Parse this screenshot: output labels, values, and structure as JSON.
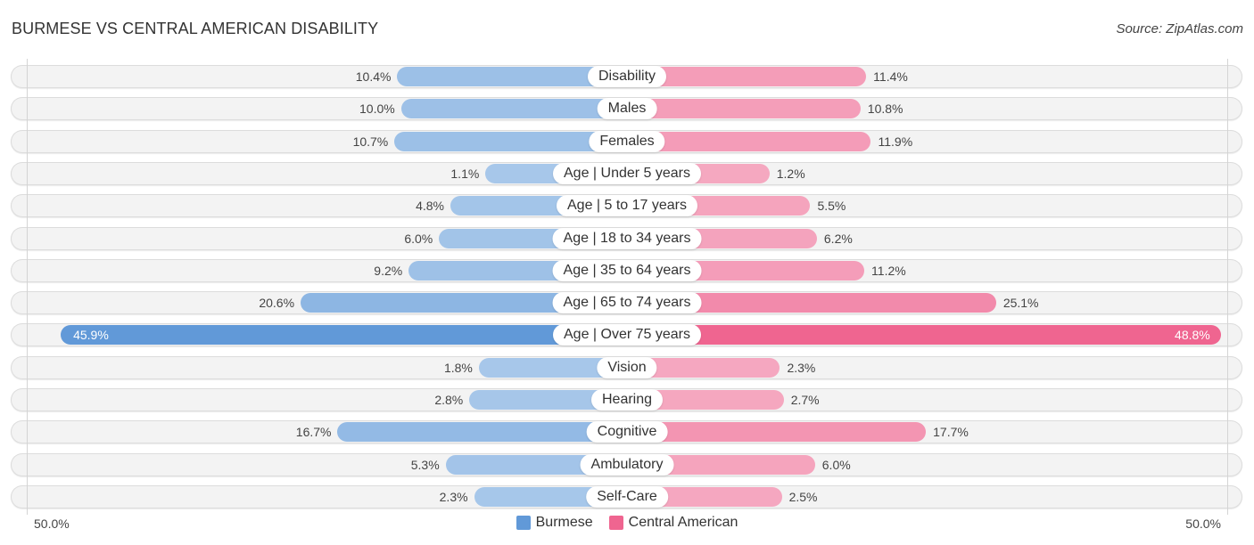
{
  "header": {
    "title": "BURMESE VS CENTRAL AMERICAN DISABILITY",
    "source": "Source: ZipAtlas.com"
  },
  "colors": {
    "burmese_light": "#a8c8ea",
    "burmese_strong": "#6199d8",
    "central_american_light": "#f5a9c1",
    "central_american_strong": "#ef6590"
  },
  "chart_data": {
    "type": "bar",
    "orientation": "horizontal-diverging",
    "title": "BURMESE VS CENTRAL AMERICAN DISABILITY",
    "categories": [
      "Disability",
      "Males",
      "Females",
      "Age | Under 5 years",
      "Age | 5 to 17 years",
      "Age | 18 to 34 years",
      "Age | 35 to 64 years",
      "Age | 65 to 74 years",
      "Age | Over 75 years",
      "Vision",
      "Hearing",
      "Cognitive",
      "Ambulatory",
      "Self-Care"
    ],
    "series": [
      {
        "name": "Burmese",
        "side": "left",
        "values": [
          10.4,
          10.0,
          10.7,
          1.1,
          4.8,
          6.0,
          9.2,
          20.6,
          45.9,
          1.8,
          2.8,
          16.7,
          5.3,
          2.3
        ],
        "labels": [
          "10.4%",
          "10.0%",
          "10.7%",
          "1.1%",
          "4.8%",
          "6.0%",
          "9.2%",
          "20.6%",
          "45.9%",
          "1.8%",
          "2.8%",
          "16.7%",
          "5.3%",
          "2.3%"
        ]
      },
      {
        "name": "Central American",
        "side": "right",
        "values": [
          11.4,
          10.8,
          11.9,
          1.2,
          5.5,
          6.2,
          11.2,
          25.1,
          48.8,
          2.3,
          2.7,
          17.7,
          6.0,
          2.5
        ],
        "labels": [
          "11.4%",
          "10.8%",
          "11.9%",
          "1.2%",
          "5.5%",
          "6.2%",
          "11.2%",
          "25.1%",
          "48.8%",
          "2.3%",
          "2.7%",
          "17.7%",
          "6.0%",
          "2.5%"
        ]
      }
    ],
    "xlim": [
      -50,
      50
    ],
    "axis_labels": {
      "left": "50.0%",
      "right": "50.0%"
    },
    "legend": {
      "position": "bottom-center",
      "entries": [
        "Burmese",
        "Central American"
      ]
    },
    "grid": false
  }
}
